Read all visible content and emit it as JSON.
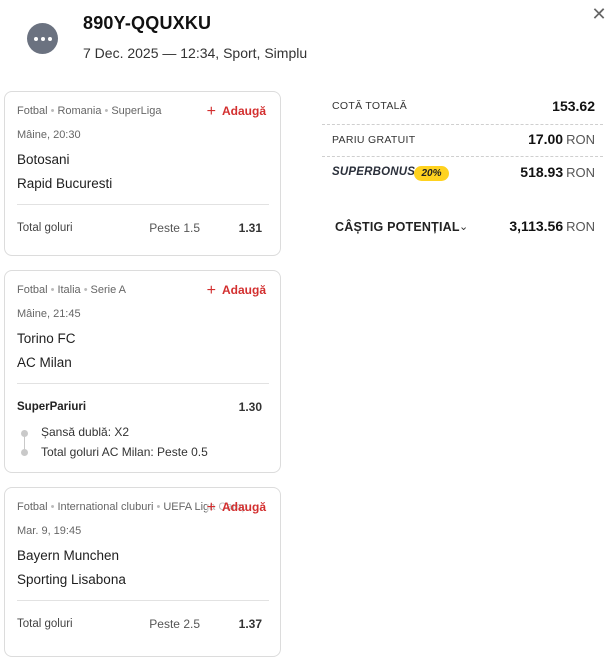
{
  "header": {
    "ticket_id": "890Y-QQUXKU",
    "meta": "7 Dec. 2025 — 12:34, Sport, Simplu",
    "icons": {
      "more": "more-horizontal-icon",
      "close": "close-icon"
    }
  },
  "events": [
    {
      "breadcrumb": [
        "Fotbal",
        "Romania",
        "SuperLiga"
      ],
      "add_label": "Adaugă",
      "time": "Mâine, 20:30",
      "home": "Botosani",
      "away": "Rapid Bucuresti",
      "market": "Total goluri",
      "selection": "Peste 1.5",
      "odd": "1.31"
    },
    {
      "breadcrumb": [
        "Fotbal",
        "Italia",
        "Serie A"
      ],
      "add_label": "Adaugă",
      "time": "Mâine, 21:45",
      "home": "Torino FC",
      "away": "AC Milan",
      "market": "SuperPariuri",
      "odd": "1.30",
      "sub_selections": [
        "Șansă dublă: X2",
        "Total goluri AC Milan: Peste 0.5"
      ]
    },
    {
      "breadcrumb": [
        "Fotbal",
        "International cluburi",
        "UEFA Liga Camp"
      ],
      "add_label": "Adaugă",
      "time": "Mar. 9, 19:45",
      "home": "Bayern Munchen",
      "away": "Sporting Lisabona",
      "market": "Total goluri",
      "selection": "Peste 2.5",
      "odd": "1.37"
    }
  ],
  "summary": {
    "cota_label": "COTĂ TOTALĂ",
    "cota_value": "153.62",
    "pariu_label": "PARIU GRATUIT",
    "pariu_value": "17.00",
    "currency": "RON",
    "superbonus_label": "SUPERBONUS",
    "superbonus_pct": "20%",
    "superbonus_value": "518.93",
    "castig_label": "CÂȘTIG POTENȚIAL",
    "castig_value": "3,113.56"
  },
  "colors": {
    "accent": "#d32f2f",
    "bonus": "#ffd21f"
  }
}
